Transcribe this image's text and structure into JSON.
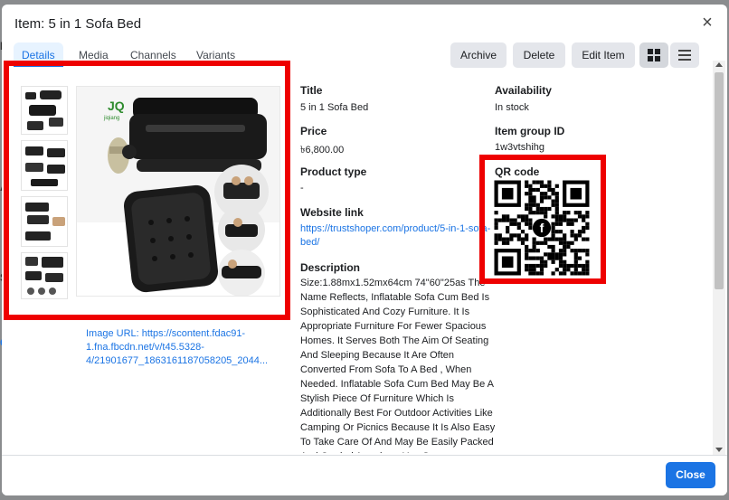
{
  "background": {
    "behind_left": [
      "F",
      "A",
      "S",
      "C"
    ]
  },
  "modal": {
    "title": "Item: 5 in 1 Sofa Bed",
    "close_glyph": "×"
  },
  "tabs": [
    "Details",
    "Media",
    "Channels",
    "Variants"
  ],
  "active_tab": "Details",
  "actions": {
    "archive": "Archive",
    "delete": "Delete",
    "edit": "Edit Item"
  },
  "view_icons": [
    "grid-view-icon",
    "list-view-icon"
  ],
  "media": {
    "image_url_label": "Image URL: ",
    "image_url_text": "https://scontent.fdac91-1.fna.fbcdn.net/v/t45.5328-4/21901677_1863161187058205_2044...",
    "brand_logo_text": "jiqiang"
  },
  "fields": {
    "title_label": "Title",
    "title_value": "5 in 1 Sofa Bed",
    "price_label": "Price",
    "price_value": "৳6,800.00",
    "product_type_label": "Product type",
    "product_type_value": "-",
    "website_label": "Website link",
    "website_value": "https://trustshoper.com/product/5-in-1-sofa-bed/",
    "description_label": "Description",
    "description_value": "Size:1.88mx1.52mx64cm 74\"60\"25as The Name Reflects, Inflatable Sofa Cum Bed Is Sophisticated And Cozy Furniture. It Is Appropriate Furniture For Fewer Spacious Homes. It Serves Both The Aim Of Seating And Sleeping Because It Are Often Converted From Sofa To A Bed , When Needed. Inflatable Sofa Cum Bed May Be A Stylish Piece Of Furniture Which Is Additionally Best For Outdoor Activities Like Camping Or Picnics Because It Is Also Easy To Take Care Of And May Be Easily Packed And Carried Anywhere You Go.",
    "availability_label": "Availability",
    "availability_value": "In stock",
    "item_group_label": "Item group ID",
    "item_group_value": "1w3vtshihg",
    "qr_label": "QR code"
  },
  "footer": {
    "close_label": "Close"
  },
  "colors": {
    "accent": "#1b74e4",
    "highlight_box": "#ee0000",
    "button_bg": "#e4e6eb"
  }
}
